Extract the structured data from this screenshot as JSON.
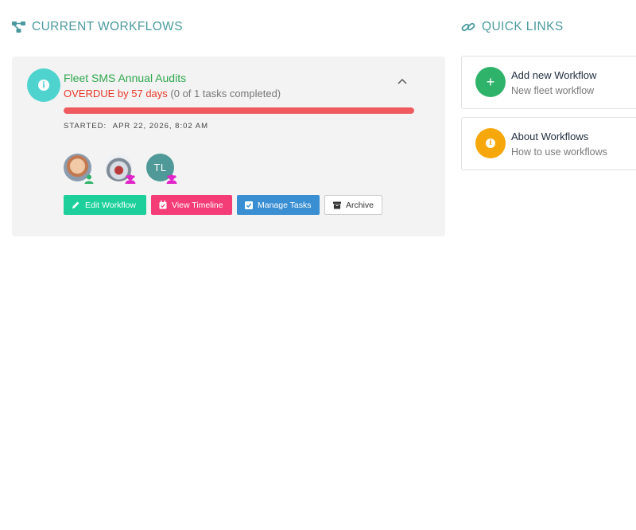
{
  "current_workflows": {
    "title": "CURRENT WORKFLOWS",
    "workflow": {
      "name": "Fleet SMS Annual Audits",
      "overdue_text": "OVERDUE by 57 days",
      "tasks_text": "(0 of 1 tasks completed)",
      "progress_fraction": 1.0,
      "progress_color": "#ef5a5e",
      "started_label": "STARTED:",
      "started_value": "APR 22, 2026, 8:02 AM",
      "assignees": [
        {
          "kind": "photo",
          "badge": "user-green"
        },
        {
          "kind": "photo",
          "badge": "group-magenta"
        },
        {
          "kind": "initials",
          "initials": "TL",
          "badge": "group-magenta"
        }
      ],
      "actions": {
        "edit": "Edit Workflow",
        "timeline": "View Timeline",
        "tasks": "Manage Tasks",
        "archive": "Archive"
      },
      "icon": "info-icon"
    }
  },
  "quick_links": {
    "title": "QUICK LINKS",
    "items": [
      {
        "title": "Add new Workflow",
        "subtitle": "New fleet workflow",
        "icon": "plus-icon",
        "color": "#2fb36b"
      },
      {
        "title": "About Workflows",
        "subtitle": "How to use workflows",
        "icon": "info-icon",
        "color": "#f5a70c"
      }
    ]
  },
  "colors": {
    "teal_heading": "#4c9a9e",
    "workflow_name": "#2fa84f",
    "overdue": "#e8382b"
  }
}
